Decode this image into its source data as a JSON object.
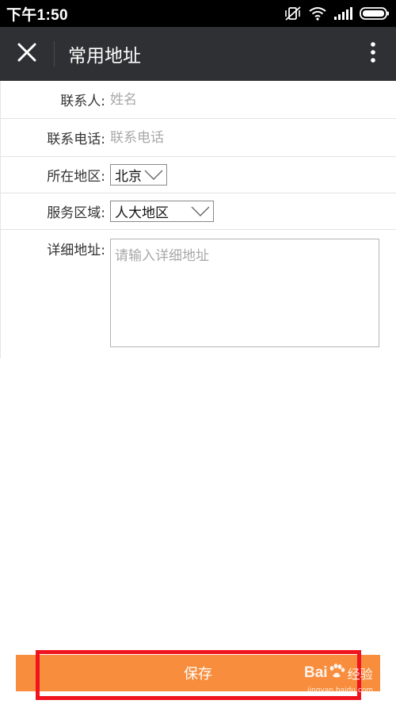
{
  "status_bar": {
    "time": "下午1:50",
    "icons": [
      "vibrate-mute-icon",
      "wifi-icon",
      "signal-icon",
      "battery-icon"
    ]
  },
  "app_bar": {
    "title": "常用地址",
    "close_icon": "close-icon",
    "menu_icon": "more-vertical-icon"
  },
  "form": {
    "contact": {
      "label": "联系人:",
      "placeholder": "姓名",
      "value": ""
    },
    "phone": {
      "label": "联系电话:",
      "placeholder": "联系电话",
      "value": ""
    },
    "region": {
      "label": "所在地区:",
      "selected": "北京"
    },
    "service_area": {
      "label": "服务区域:",
      "selected": "人大地区"
    },
    "address": {
      "label": "详细地址:",
      "placeholder": "请输入详细地址",
      "value": ""
    }
  },
  "save_button": {
    "label": "保存"
  },
  "watermark": {
    "brand": "Bai",
    "brand_cn": "经验",
    "url": "jingyan.baidu.com"
  },
  "colors": {
    "status_bar_bg": "#000000",
    "app_bar_bg": "#2f3033",
    "save_button_bg": "#f78d3d",
    "highlight_border": "#f0141e"
  }
}
